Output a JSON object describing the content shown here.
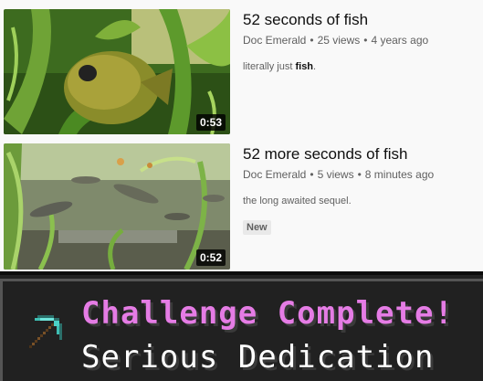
{
  "videos": [
    {
      "title": "52 seconds of fish",
      "channel": "Doc Emerald",
      "views": "25 views",
      "age": "4 years ago",
      "description_prefix": "literally just ",
      "description_bold": "fish",
      "description_suffix": ".",
      "duration": "0:53",
      "badge": ""
    },
    {
      "title": "52 more seconds of fish",
      "channel": "Doc Emerald",
      "views": "5 views",
      "age": "8 minutes ago",
      "description_prefix": "the long awaited sequel.",
      "description_bold": "",
      "description_suffix": "",
      "duration": "0:52",
      "badge": "New"
    }
  ],
  "toast": {
    "title": "Challenge Complete!",
    "subtitle": "Serious Dedication",
    "icon": "diamond-pickaxe-icon",
    "title_color": "#e57ce5",
    "subtitle_color": "#ffffff"
  },
  "colors": {
    "page_bg": "#f9f9f9",
    "title_text": "#0f0f0f",
    "meta_text": "#606060",
    "toast_bg": "#212121"
  }
}
